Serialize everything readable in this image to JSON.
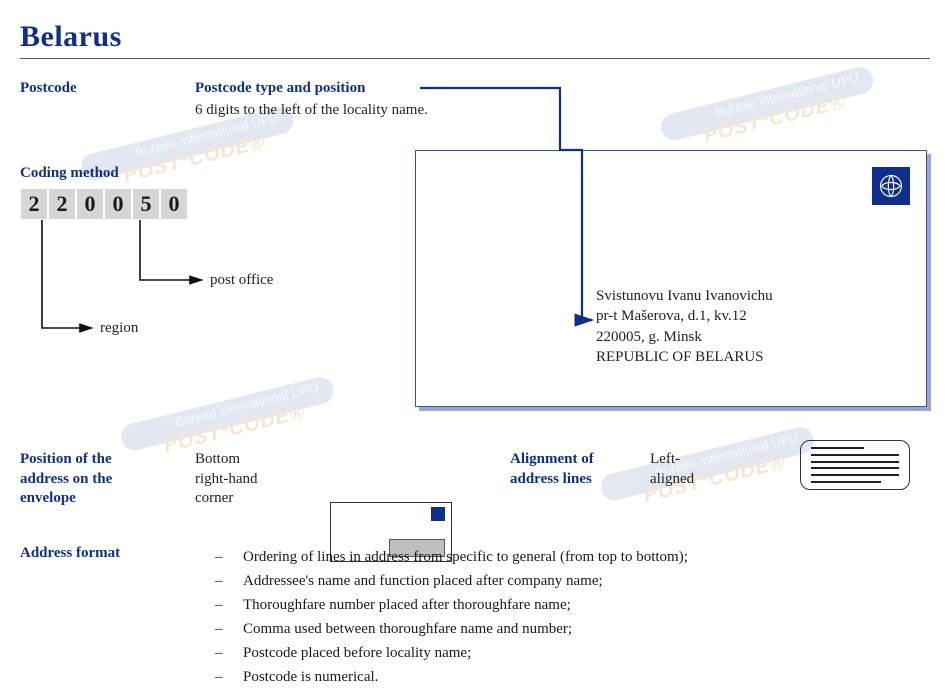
{
  "title": "Belarus",
  "sections": {
    "postcode_label": "Postcode",
    "postcode_type_label": "Postcode type and position",
    "postcode_type_desc": "6 digits to the left of the locality name.",
    "coding_method_label": "Coding method",
    "coding_digits": [
      "2",
      "2",
      "0",
      "0",
      "5",
      "0"
    ],
    "coding_post_office": "post office",
    "coding_region": "region",
    "position_label_l1": "Position of the",
    "position_label_l2": "address on  the",
    "position_label_l3": "envelope",
    "position_value_l1": "Bottom",
    "position_value_l2": "right-hand",
    "position_value_l3": "corner",
    "alignment_label_l1": "Alignment of",
    "alignment_label_l2": "address lines",
    "alignment_value_l1": "Left-",
    "alignment_value_l2": "aligned",
    "address_format_label": "Address format",
    "bullets": [
      "Ordering of lines in address from specific to general (from top to bottom);",
      "Addressee's name and function placed after company name;",
      "Thoroughfare number placed after thoroughfare name;",
      "Comma used between thoroughfare name and number;",
      "Postcode placed before locality name;",
      "Postcode is numerical."
    ]
  },
  "envelope_address": {
    "line1": "Svistunovu Ivanu Ivanovichu",
    "line2": "pr-t Mašerova, d.1, kv.12",
    "line3": "220005, g. Minsk",
    "line4": "REPUBLIC OF BELARUS"
  },
  "watermark": {
    "org": "Bureau international UPU",
    "code": "POST*CODE®"
  }
}
